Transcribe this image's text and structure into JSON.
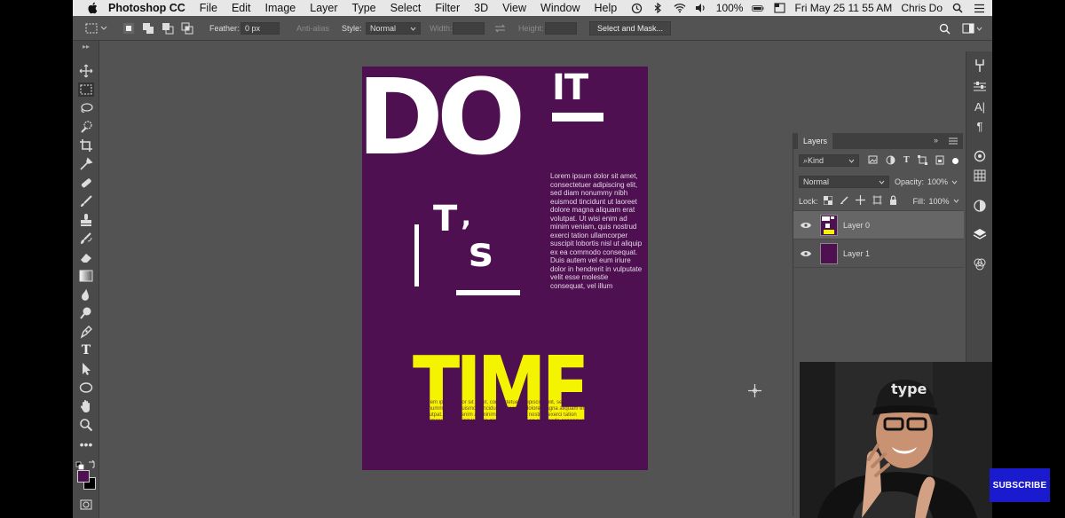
{
  "menubar": {
    "app_name": "Photoshop CC",
    "menus": [
      "File",
      "Edit",
      "Image",
      "Layer",
      "Type",
      "Select",
      "Filter",
      "3D",
      "View",
      "Window",
      "Help"
    ],
    "battery": "100%",
    "datetime": "Fri May 25  11 55 AM",
    "user": "Chris Do"
  },
  "options": {
    "feather_label": "Feather:",
    "feather_value": "0 px",
    "antialias_label": "Anti-alias",
    "style_label": "Style:",
    "style_value": "Normal",
    "width_label": "Width:",
    "height_label": "Height:",
    "select_mask_label": "Select and Mask..."
  },
  "tools": [
    "move-tool",
    "marquee-tool",
    "lasso-tool",
    "quick-select-tool",
    "crop-tool",
    "eyedropper-tool",
    "healing-tool",
    "brush-tool",
    "stamp-tool",
    "history-brush-tool",
    "eraser-tool",
    "gradient-tool",
    "blur-tool",
    "dodge-tool",
    "pen-tool",
    "type-tool",
    "path-select-tool",
    "shape-tool",
    "hand-tool",
    "zoom-tool",
    "more-tools"
  ],
  "colors": {
    "foreground": "#4e1050",
    "background": "#000000",
    "poster_bg": "#4e1050",
    "poster_accent": "#f5f400",
    "subscribe_bg": "#1a1acf"
  },
  "poster": {
    "do": "DO",
    "it": "IT",
    "t": "T",
    "apostrophe": "’",
    "s": "s",
    "time": "TIME",
    "lorem": "Lorem ipsum dolor sit amet, consectetuer adipiscing elit, sed diam nonummy nibh euismod tincidunt ut laoreet dolore magna aliquam erat volutpat. Ut wisi enim ad minim veniam, quis nostrud exerci tation ullamcorper suscipit lobortis nisl ut aliquip ex ea commodo consequat. Duis autem vel eum iriure dolor in hendrerit in vulputate velit esse molestie consequat, vel illum",
    "time_fill": "Lorem ipsum dolor sit amet, consectetuer adipiscing elit, sed diam nonummy nibh euismod tincidunt ut laoreet dolore magna aliquam erat volutpat. Ut wisi enim ad minim veniam, quis nostrud exerci tation ullamcorper suscipit lobortis nisl ut aliquip ex ea commodo consequat. Duis autem vel eum iriure dolor in hendrerit in vulputate velit esse molestie consequat, vel illum dolore eu feugiat nulla facilisis at vero eros et accumsan et iusto odio dignissim qui blandit praesent"
  },
  "layers_panel": {
    "title": "Layers",
    "filter_label": "Kind",
    "blend_mode": "Normal",
    "opacity_label": "Opacity:",
    "opacity_value": "100%",
    "lock_label": "Lock:",
    "fill_label": "Fill:",
    "fill_value": "100%",
    "layers": [
      {
        "name": "Layer 0",
        "selected": true
      },
      {
        "name": "Layer 1",
        "selected": false
      }
    ]
  },
  "webcam": {
    "cap_text": "type"
  },
  "subscribe_label": "SUBSCRIBE"
}
